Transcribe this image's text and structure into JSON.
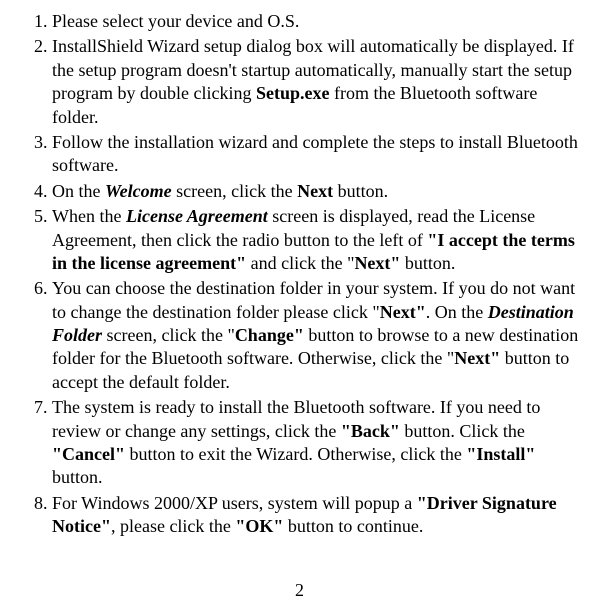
{
  "items": [
    {
      "segments": [
        {
          "text": "Please select your device and O.S."
        }
      ]
    },
    {
      "segments": [
        {
          "text": "InstallShield Wizard setup dialog box will automatically be displayed. If the setup program doesn't startup automatically, manually start the setup program by double clicking "
        },
        {
          "text": "Setup.exe",
          "class": "bold"
        },
        {
          "text": " from the Bluetooth software folder."
        }
      ]
    },
    {
      "segments": [
        {
          "text": "Follow the installation wizard and complete the steps to install Bluetooth software."
        }
      ]
    },
    {
      "segments": [
        {
          "text": "On the "
        },
        {
          "text": "Welcome",
          "class": "bold-italic"
        },
        {
          "text": " screen, click the "
        },
        {
          "text": "Next",
          "class": "bold"
        },
        {
          "text": " button."
        }
      ]
    },
    {
      "segments": [
        {
          "text": "When the "
        },
        {
          "text": "License Agreement",
          "class": "bold-italic"
        },
        {
          "text": " screen is displayed, read the License Agreement, then click the radio button to the left of "
        },
        {
          "text": "\"I accept the terms in the license agreement\"",
          "class": "bold"
        },
        {
          "text": " and click the \""
        },
        {
          "text": "Next\"",
          "class": "bold"
        },
        {
          "text": " button."
        }
      ]
    },
    {
      "segments": [
        {
          "text": "You can choose the destination folder in your system. If you do not want to change the destination folder please click \""
        },
        {
          "text": "Next\"",
          "class": "bold"
        },
        {
          "text": ". On the "
        },
        {
          "text": "Destination Folder",
          "class": "bold-italic"
        },
        {
          "text": " screen, click the \""
        },
        {
          "text": "Change\"",
          "class": "bold"
        },
        {
          "text": " button to browse to a new destination folder for the Bluetooth software. Otherwise, click the \""
        },
        {
          "text": "Next\"",
          "class": "bold"
        },
        {
          "text": " button to accept the default folder."
        }
      ]
    },
    {
      "segments": [
        {
          "text": "The system is ready to install the Bluetooth software. If you need to review or change any settings, click the "
        },
        {
          "text": "\"Back\"",
          "class": "bold"
        },
        {
          "text": " button. Click the "
        },
        {
          "text": "\"Cancel\"",
          "class": "bold"
        },
        {
          "text": " button to exit the Wizard. Otherwise, click the "
        },
        {
          "text": "\"Install\"",
          "class": "bold"
        },
        {
          "text": " button."
        }
      ]
    },
    {
      "segments": [
        {
          "text": "For Windows 2000/XP users, system will popup a "
        },
        {
          "text": "\"Driver Signature Notice\"",
          "class": "bold"
        },
        {
          "text": ", please click the "
        },
        {
          "text": "\"OK\"",
          "class": "bold"
        },
        {
          "text": " button to continue."
        }
      ]
    }
  ],
  "page_number": "2"
}
